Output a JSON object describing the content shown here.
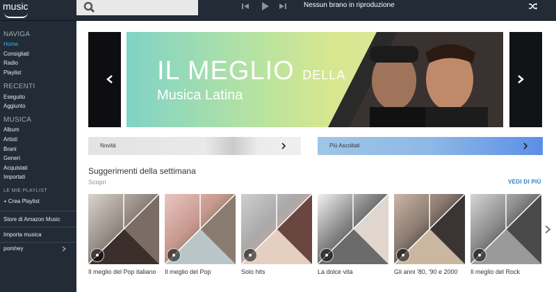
{
  "app": {
    "logo_text": "music"
  },
  "player": {
    "now_playing": "Nessun brano in riproduzione"
  },
  "sidebar": {
    "naviga": {
      "title": "NAVIGA",
      "items": [
        "Home",
        "Consigliati",
        "Radio",
        "Playlist"
      ]
    },
    "recenti": {
      "title": "RECENTI",
      "items": [
        "Eseguito",
        "Aggiunto"
      ]
    },
    "musica": {
      "title": "MUSICA",
      "items": [
        "Album",
        "Artisti",
        "Brani",
        "Generi",
        "Acquistati",
        "Importati"
      ]
    },
    "playlist": {
      "title": "LE MIE PLAYLIST",
      "create": "+ Crea Playlist"
    },
    "store": "Store di Amazon Music",
    "import": "Importa musica",
    "user": "pomhey"
  },
  "banner": {
    "line1": "IL MEGLIO",
    "line1b": "DELLA",
    "line2": "Musica Latina"
  },
  "sub_buttons": {
    "novita": "Novità",
    "piu_ascoltati": "Più Ascoltati"
  },
  "suggestions": {
    "title": "Suggerimenti della settimana",
    "subtitle": "Scopri",
    "see_more": "VEDI DI PIÙ",
    "cards": [
      {
        "label": "Il meglio del Pop italiano"
      },
      {
        "label": "Il meglio del Pop"
      },
      {
        "label": "Solo hits"
      },
      {
        "label": "La dolce vita"
      },
      {
        "label": "Gli anni '80, '90 e 2000"
      },
      {
        "label": "Il meglio del Rock"
      }
    ]
  },
  "colors": {
    "sidebar_bg": "#222b36",
    "accent": "#2bb3ff",
    "link": "#2b7ec1"
  }
}
